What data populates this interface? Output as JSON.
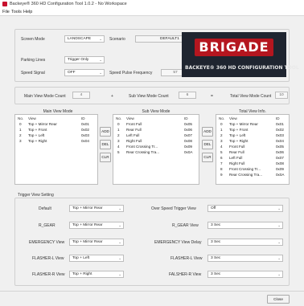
{
  "window": {
    "title": "Backeye® 360 HD Configuration Tool 1.0.2 - No Workspace"
  },
  "menu": [
    "File",
    "Tools",
    "Help"
  ],
  "settings": {
    "screen_mode_label": "Screen Mode",
    "screen_mode_value": "LANDSCAPE",
    "scenario_label": "Scenario",
    "scenario_value": "DEFAULT1",
    "parking_lines_label": "Parking Lines",
    "parking_lines_value": "Trigger Only",
    "speed_signal_label": "Speed Signal",
    "speed_signal_value": "OFF",
    "speed_pulse_label": "Speed Pulse Frequency",
    "speed_pulse_value": "57"
  },
  "brand": {
    "logo_text": "BRIGADE",
    "tagline": "BACKEYE® 360 HD CONFIGURATION TOOL",
    "colors": {
      "logo_red": "#b5161f",
      "panel_dark": "#1f2530"
    }
  },
  "counts": {
    "main_label": "Main View Mode Count",
    "main_value": "4",
    "plus": "+",
    "sub_label": "Sub View Mode Count",
    "sub_value": "6",
    "equals": "=",
    "total_label": "Total View Mode Count",
    "total_value": "10"
  },
  "main_view": {
    "title": "Main View Mode",
    "col_no": "No.",
    "col_view": "View",
    "col_id": "ID",
    "rows": [
      {
        "no": "0",
        "view": "Top + Mirror Rear",
        "id": "0x01"
      },
      {
        "no": "1",
        "view": "Top + Front",
        "id": "0x02"
      },
      {
        "no": "2",
        "view": "Top + Left",
        "id": "0x03"
      },
      {
        "no": "3",
        "view": "Top + Right",
        "id": "0x04"
      }
    ],
    "btn_add": "ADD",
    "btn_del": "DEL",
    "btn_clr": "CLR"
  },
  "sub_view": {
    "title": "Sub View Mode",
    "col_no": "No.",
    "col_view": "View",
    "col_id": "ID",
    "rows": [
      {
        "no": "0",
        "view": "Front Full",
        "id": "0x05"
      },
      {
        "no": "1",
        "view": "Rear Full",
        "id": "0x06"
      },
      {
        "no": "2",
        "view": "Left Full",
        "id": "0x07"
      },
      {
        "no": "3",
        "view": "Right Full",
        "id": "0x08"
      },
      {
        "no": "4",
        "view": "Front Crossing Tr...",
        "id": "0x09"
      },
      {
        "no": "5",
        "view": "Rear Crossing Tra...",
        "id": "0x0A"
      }
    ],
    "btn_add": "ADD",
    "btn_del": "DEL",
    "btn_clr": "CLR"
  },
  "total_view": {
    "title": "Total View Info.",
    "col_no": "No.",
    "col_view": "View",
    "col_id": "ID",
    "rows": [
      {
        "no": "0",
        "view": "Top + Mirror Rear",
        "id": "0x01"
      },
      {
        "no": "1",
        "view": "Top + Front",
        "id": "0x02"
      },
      {
        "no": "2",
        "view": "Top + Left",
        "id": "0x03"
      },
      {
        "no": "3",
        "view": "Top + Right",
        "id": "0x04"
      },
      {
        "no": "4",
        "view": "Front Full",
        "id": "0x05"
      },
      {
        "no": "5",
        "view": "Rear Full",
        "id": "0x06"
      },
      {
        "no": "6",
        "view": "Left Full",
        "id": "0x07"
      },
      {
        "no": "7",
        "view": "Right Full",
        "id": "0x08"
      },
      {
        "no": "8",
        "view": "Front Crossing Tr...",
        "id": "0x09"
      },
      {
        "no": "9",
        "view": "Rear Crossing Tra...",
        "id": "0x0A"
      }
    ]
  },
  "trigger": {
    "title": "Trigger View Setting",
    "left": [
      {
        "label": "Default",
        "value": "Top + Mirror Rear"
      },
      {
        "label": "R_GEAR",
        "value": "Top + Mirror Rear"
      },
      {
        "label": "EMERGENCY View",
        "value": "Top + Mirror Rear"
      },
      {
        "label": "FLASHER-L View",
        "value": "Top + Left"
      },
      {
        "label": "FLASHER-R View",
        "value": "Top + Right"
      }
    ],
    "right": [
      {
        "label": "Over Speed Trigger View",
        "value": "Off"
      },
      {
        "label": "R_GEAR View",
        "value": "3 Sec"
      },
      {
        "label": "EMERGENCY View Delay",
        "value": "3 Sec"
      },
      {
        "label": "FLASHER-L View",
        "value": "3 Sec"
      },
      {
        "label": "FALSHER-R View",
        "value": "3 Sec"
      }
    ]
  },
  "footer": {
    "close_label": "Close"
  }
}
